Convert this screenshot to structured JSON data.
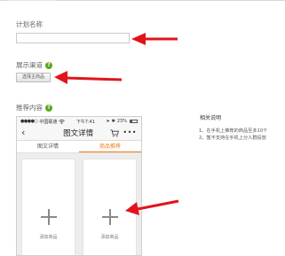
{
  "plan_name": {
    "label": "计划名称",
    "value": ""
  },
  "channel": {
    "label": "展示渠道",
    "help_icon": "question-icon",
    "button_label": "选择主商品"
  },
  "content": {
    "label": "推荐内容",
    "help_icon": "question-icon"
  },
  "phone": {
    "status": {
      "dots": "●●●●○",
      "carrier": "中国联通",
      "wifi": "wifi-icon",
      "time": "下午7:41",
      "battery_text": "23%"
    },
    "nav": {
      "back": "‹",
      "title": "图文详情",
      "cart_icon": "cart-icon",
      "more": "•••"
    },
    "tabs": [
      {
        "label": "图文详情",
        "active": false
      },
      {
        "label": "商品推荐",
        "active": true
      }
    ],
    "cards": [
      {
        "label": "添加商品"
      },
      {
        "label": "添加商品"
      }
    ]
  },
  "notes": {
    "title": "相关说明",
    "lines": [
      "1、在手机上推荐的商品至多10个",
      "2、暂不支持在手机上分人群投放"
    ]
  },
  "colors": {
    "accent": "#f27a13",
    "help": "#5aa81e",
    "arrow": "#e2141b"
  }
}
